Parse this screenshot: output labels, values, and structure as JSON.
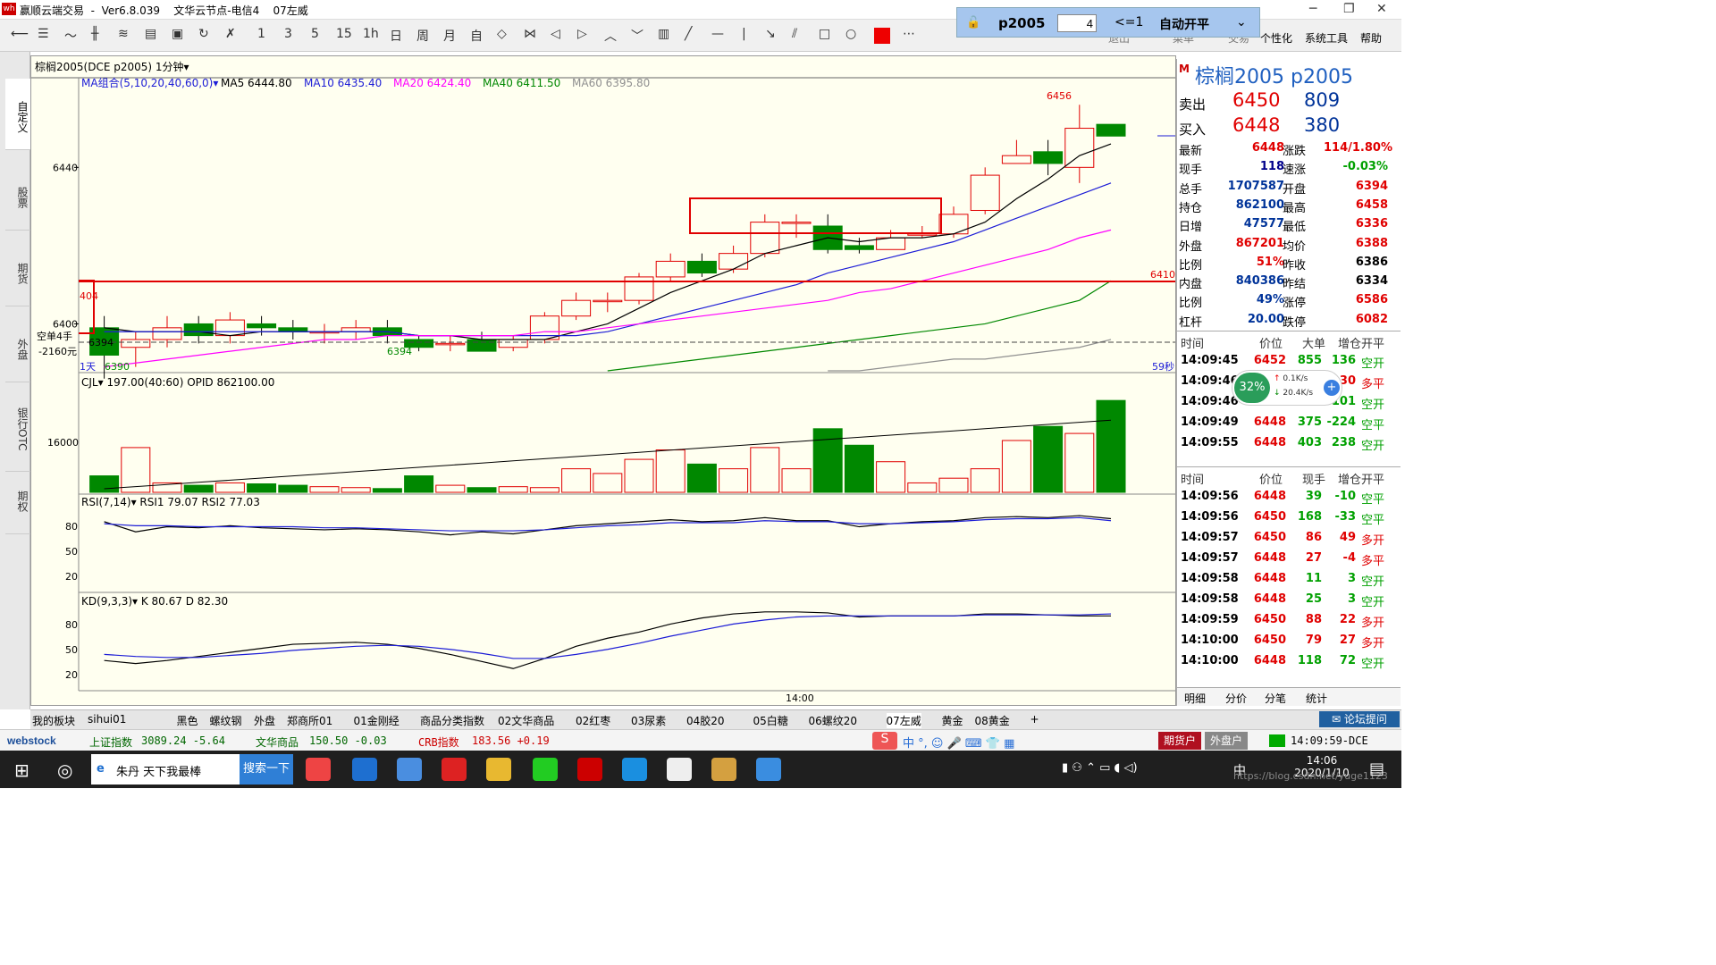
{
  "window": {
    "title": "赢顺云端交易  -  Ver6.8.039    文华云节点-电信4    07左威",
    "controls": [
      "─",
      "❐",
      "✕"
    ]
  },
  "toolbar": {
    "icons": [
      "back-arrow-icon",
      "list-icon",
      "line-chart-icon",
      "kline-icon",
      "tick-icon",
      "table-icon",
      "save-icon",
      "refresh-icon",
      "cross-chart-icon"
    ],
    "periods": [
      "1",
      "3",
      "5",
      "15",
      "1h",
      "日",
      "周",
      "月",
      "自"
    ],
    "menu": [
      "退出",
      "菜单",
      "交易",
      "个性化",
      "系统工具",
      "帮助"
    ],
    "trade": {
      "symbol": "p2005",
      "qty": "4",
      "cond": "<=1",
      "mode": "自动开平"
    }
  },
  "leftnav": [
    "自定义",
    "股票",
    "期货",
    "外盘",
    "银行OTC",
    "期权"
  ],
  "chart": {
    "header": "棕榈2005(DCE p2005)  1分钟▾",
    "ma_label": "MA组合(5,10,20,40,60,0)▾",
    "ma_values": [
      {
        "t": "MA5 6444.80",
        "c": "#000000"
      },
      {
        "t": "MA10 6435.40",
        "c": "#1d1dd6"
      },
      {
        "t": "MA20 6424.40",
        "c": "#ff00ff"
      },
      {
        "t": "MA40 6411.50",
        "c": "#008800"
      },
      {
        "t": "MA60 6395.80",
        "c": "#909090"
      }
    ],
    "y_labels": [
      {
        "t": "6440",
        "v": 6440
      },
      {
        "t": "6400",
        "v": 6400
      }
    ],
    "high_label": "6456",
    "low_label": "6390",
    "mid_low_label": "6394",
    "line_label": "6410",
    "avg_label": "6394",
    "pos_label_1": "空单4手",
    "pos_label_2": "-2160元",
    "left_label": "404",
    "period_corner": "1天",
    "sec_label": "59秒",
    "vol_label": "CJL▾  197.00(40:60)   OPID 862100.00",
    "vol_ylabel": "16000",
    "rsi_label": "RSI(7,14)▾  RSI1 79.07   RSI2 77.03",
    "rsi_levels": [
      "80",
      "50",
      "20"
    ],
    "kd_label": "KD(9,3,3)▾  K 80.67    D 82.30",
    "kd_levels": [
      "80",
      "50",
      "20"
    ],
    "time_label": "14:00"
  },
  "chart_data": {
    "type": "candlestick",
    "ylim": [
      6388,
      6462
    ],
    "candles": [
      [
        6399,
        6392,
        6402,
        6386
      ],
      [
        6394,
        6396,
        6398,
        6389
      ],
      [
        6396,
        6399,
        6402,
        6394
      ],
      [
        6400,
        6397,
        6402,
        6395
      ],
      [
        6397,
        6401,
        6403,
        6395
      ],
      [
        6400,
        6399,
        6402,
        6397
      ],
      [
        6399,
        6398,
        6401,
        6396
      ],
      [
        6398,
        6398,
        6400,
        6395
      ],
      [
        6398,
        6399,
        6401,
        6396
      ],
      [
        6399,
        6397,
        6401,
        6395
      ],
      [
        6396,
        6394,
        6397,
        6393
      ],
      [
        6395,
        6395,
        6397,
        6393
      ],
      [
        6396,
        6393,
        6398,
        6393
      ],
      [
        6394,
        6396,
        6397,
        6393
      ],
      [
        6396,
        6402,
        6403,
        6395
      ],
      [
        6402,
        6406,
        6408,
        6401
      ],
      [
        6406,
        6406,
        6408,
        6403
      ],
      [
        6406,
        6412,
        6413,
        6405
      ],
      [
        6412,
        6416,
        6418,
        6411
      ],
      [
        6416,
        6413,
        6418,
        6412
      ],
      [
        6414,
        6418,
        6420,
        6413
      ],
      [
        6418,
        6426,
        6428,
        6417
      ],
      [
        6426,
        6426,
        6428,
        6422
      ],
      [
        6425,
        6419,
        6428,
        6418
      ],
      [
        6420,
        6419,
        6422,
        6418
      ],
      [
        6419,
        6422,
        6424,
        6419
      ],
      [
        6423,
        6423,
        6425,
        6422
      ],
      [
        6423,
        6428,
        6430,
        6422
      ],
      [
        6429,
        6438,
        6440,
        6428
      ],
      [
        6441,
        6443,
        6447,
        6441
      ],
      [
        6444,
        6441,
        6447,
        6438
      ],
      [
        6440,
        6450,
        6456,
        6436
      ],
      [
        6451,
        6448,
        6451,
        6448
      ]
    ],
    "ma": [
      {
        "name": "MA5",
        "color": "#000000",
        "values": [
          6399,
          6398,
          6398,
          6398,
          6397,
          6398,
          6398,
          6398,
          6398,
          6398,
          6397,
          6397,
          6396,
          6396,
          6396,
          6398,
          6400,
          6404,
          6408,
          6411,
          6414,
          6418,
          6420,
          6422,
          6421,
          6422,
          6422,
          6423,
          6426,
          6432,
          6437,
          6443,
          6446
        ]
      },
      {
        "name": "MA10",
        "color": "#1d1dd6",
        "values": [
          6398,
          6398,
          6398,
          6398,
          6398,
          6398,
          6398,
          6398,
          6398,
          6398,
          6397,
          6397,
          6397,
          6397,
          6397,
          6397,
          6398,
          6400,
          6402,
          6404,
          6406,
          6408,
          6410,
          6413,
          6415,
          6417,
          6419,
          6421,
          6424,
          6427,
          6430,
          6433,
          6436
        ]
      },
      {
        "name": "MA20",
        "color": "#ff00ff",
        "values": [
          6389,
          6390,
          6391,
          6392,
          6393,
          6394,
          6395,
          6396,
          6396,
          6397,
          6397,
          6397,
          6397,
          6397,
          6398,
          6398,
          6399,
          6400,
          6401,
          6402,
          6403,
          6404,
          6405,
          6406,
          6408,
          6409,
          6411,
          6413,
          6415,
          6417,
          6419,
          6422,
          6424
        ]
      },
      {
        "name": "MA40",
        "color": "#008800",
        "values": [
          null,
          null,
          null,
          null,
          null,
          null,
          null,
          null,
          null,
          null,
          null,
          null,
          null,
          null,
          null,
          null,
          6388,
          6389,
          6390,
          6391,
          6392,
          6393,
          6394,
          6395,
          6396,
          6397,
          6398,
          6399,
          6400,
          6402,
          6404,
          6406,
          6411
        ]
      },
      {
        "name": "MA60",
        "color": "#909090",
        "values": [
          null,
          null,
          null,
          null,
          null,
          null,
          null,
          null,
          null,
          null,
          null,
          null,
          null,
          null,
          null,
          null,
          null,
          null,
          null,
          null,
          null,
          null,
          null,
          6388,
          6388,
          6389,
          6390,
          6391,
          6391,
          6392,
          6393,
          6394,
          6396
        ]
      }
    ],
    "volume": [
      3500,
      9500,
      2000,
      1500,
      2000,
      1800,
      1500,
      1200,
      1000,
      800,
      3500,
      1500,
      1000,
      1200,
      1000,
      5000,
      4000,
      7000,
      9000,
      6000,
      5000,
      9500,
      5000,
      13500,
      10000,
      6500,
      2000,
      3000,
      5000,
      11000,
      14000,
      12500,
      19500
    ],
    "volume_ylim": [
      0,
      22000
    ],
    "rsi1": [
      76,
      66,
      71,
      70,
      72,
      70,
      69,
      68,
      69,
      68,
      66,
      63,
      66,
      64,
      68,
      72,
      74,
      76,
      78,
      76,
      77,
      80,
      77,
      77,
      71,
      74,
      76,
      77,
      80,
      81,
      80,
      82,
      79
    ],
    "rsi2": [
      74,
      72,
      72,
      71,
      71,
      71,
      71,
      70,
      70,
      69,
      68,
      67,
      67,
      67,
      68,
      70,
      72,
      73,
      75,
      75,
      75,
      77,
      76,
      76,
      74,
      74,
      75,
      76,
      78,
      79,
      79,
      80,
      77
    ],
    "k": [
      36,
      33,
      36,
      40,
      44,
      48,
      52,
      53,
      54,
      52,
      48,
      42,
      35,
      28,
      38,
      50,
      58,
      64,
      72,
      78,
      82,
      84,
      84,
      83,
      79,
      80,
      80,
      80,
      82,
      82,
      81,
      80,
      80
    ],
    "d": [
      42,
      40,
      39,
      39,
      41,
      43,
      46,
      48,
      50,
      51,
      50,
      47,
      43,
      38,
      38,
      42,
      47,
      53,
      60,
      66,
      72,
      76,
      79,
      80,
      80,
      80,
      80,
      80,
      81,
      81,
      81,
      81,
      82
    ]
  },
  "quote": {
    "title": "棕榈2005  p2005",
    "mark": "M",
    "ask": {
      "label": "卖出",
      "price": "6450",
      "vol": "809"
    },
    "bid": {
      "label": "买入",
      "price": "6448",
      "vol": "380"
    },
    "stats": [
      [
        "最新",
        "6448",
        "red",
        "涨跌",
        "114/1.80%",
        "red"
      ],
      [
        "现手",
        "118",
        "blue",
        "速涨",
        "-0.03%",
        "green"
      ],
      [
        "总手",
        "1707587",
        "navy",
        "开盘",
        "6394",
        "red"
      ],
      [
        "持仓",
        "862100",
        "navy",
        "最高",
        "6458",
        "red"
      ],
      [
        "日增",
        "47577",
        "navy",
        "最低",
        "6336",
        "red"
      ],
      [
        "外盘",
        "867201",
        "red",
        "均价",
        "6388",
        "red"
      ],
      [
        "比例",
        "51%",
        "red",
        "昨收",
        "6386",
        "blk"
      ],
      [
        "内盘",
        "840386",
        "navy",
        "昨结",
        "6334",
        "blk"
      ],
      [
        "比例",
        "49%",
        "navy",
        "涨停",
        "6586",
        "red"
      ],
      [
        "杠杆",
        "20.00",
        "navy",
        "跌停",
        "6082",
        "red"
      ]
    ],
    "big_header": [
      "时间",
      "价位",
      "大单",
      "增仓",
      "开平"
    ],
    "big": [
      [
        "14:09:45",
        "6452",
        "855",
        "136",
        "空开"
      ],
      [
        "14:09:46",
        "6448",
        "409",
        "30",
        "多平"
      ],
      [
        "14:09:46",
        "6448",
        "403",
        "101",
        "空开"
      ],
      [
        "14:09:49",
        "6448",
        "375",
        "-224",
        "空平"
      ],
      [
        "14:09:55",
        "6448",
        "403",
        "238",
        "空开"
      ]
    ],
    "tick_header": [
      "时间",
      "价位",
      "现手",
      "增仓",
      "开平"
    ],
    "ticks": [
      [
        "14:09:56",
        "6448",
        "39",
        "-10",
        "空平",
        "g"
      ],
      [
        "14:09:56",
        "6450",
        "168",
        "-33",
        "空平",
        "g"
      ],
      [
        "14:09:57",
        "6450",
        "86",
        "49",
        "多开",
        "r"
      ],
      [
        "14:09:57",
        "6448",
        "27",
        "-4",
        "多平",
        "r"
      ],
      [
        "14:09:58",
        "6448",
        "11",
        "3",
        "空开",
        "g"
      ],
      [
        "14:09:58",
        "6448",
        "25",
        "3",
        "空开",
        "g"
      ],
      [
        "14:09:59",
        "6450",
        "88",
        "22",
        "多开",
        "r"
      ],
      [
        "14:10:00",
        "6450",
        "79",
        "27",
        "多开",
        "r"
      ],
      [
        "14:10:00",
        "6448",
        "118",
        "72",
        "空开",
        "g"
      ]
    ],
    "tabs": [
      "明细",
      "分价",
      "分笔",
      "统计"
    ],
    "widget": {
      "pct": "32%",
      "up": "0.1K/s",
      "down": "20.4K/s"
    }
  },
  "bottom_tabs": [
    "我的板块",
    "sihui01",
    "黑色",
    "螺纹钢",
    "外盘",
    "郑商所01",
    "01金刚经",
    "商品分类指数",
    "02文华商品",
    "02红枣",
    "03尿素",
    "04胶20",
    "05白糖",
    "06螺纹20",
    "07左威",
    "黄金",
    "08黄金",
    "+"
  ],
  "forum": "论坛提问",
  "index_bar": {
    "brand": "webstock",
    "items": [
      {
        "name": "上证指数",
        "val": "3089.24  -5.64"
      },
      {
        "name": "文华商品",
        "val": "150.50  -0.03"
      },
      {
        "name": "CRB指数",
        "val": "183.56  +0.19"
      }
    ],
    "acct1": "期货户",
    "acct2": "外盘户",
    "time": "14:09:59-DCE"
  },
  "taskbar": {
    "search_text": "朱丹 天下我最棒",
    "search_btn": "搜索一下",
    "clock_time": "14:06",
    "clock_date": "2020/1/10",
    "watermark": "https://blog.csdn.net/yuge1123",
    "lang": "中"
  }
}
